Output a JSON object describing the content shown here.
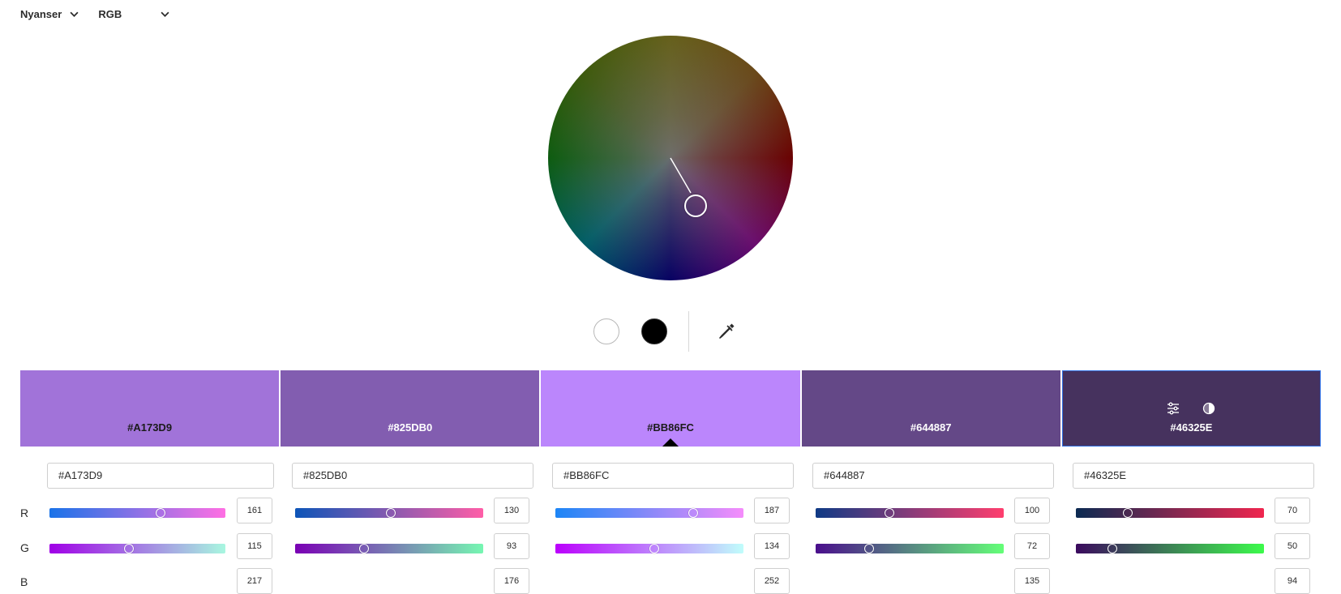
{
  "toolbar": {
    "mode": "Nyanser",
    "colormodel": "RGB"
  },
  "wheel": {
    "handle_color": "#BB86FC"
  },
  "tools": {
    "white_label": "white",
    "black_label": "black"
  },
  "row_labels": [
    "R",
    "G",
    "B"
  ],
  "swatches": [
    {
      "hex": "#A173D9",
      "bg": "#A173D9",
      "text_color": "#1b1b1b"
    },
    {
      "hex": "#825DB0",
      "bg": "#825DB0",
      "text_color": "#ffffff"
    },
    {
      "hex": "#BB86FC",
      "bg": "#BB86FC",
      "text_color": "#1b1b1b"
    },
    {
      "hex": "#644887",
      "bg": "#644887",
      "text_color": "#ffffff"
    },
    {
      "hex": "#46325E",
      "bg": "#46325E",
      "text_color": "#ffffff"
    }
  ],
  "editors": [
    {
      "hex": "#A173D9",
      "r": "161",
      "g": "115",
      "b": "217",
      "r_grad": [
        "#1a73e8",
        "#ff6fe3"
      ],
      "g_grad": [
        "#a000e6",
        "#a8f7e0"
      ]
    },
    {
      "hex": "#825DB0",
      "r": "130",
      "g": "93",
      "b": "176",
      "r_grad": [
        "#0d55b8",
        "#ff5ea7"
      ],
      "g_grad": [
        "#7a00b4",
        "#76f7b2"
      ]
    },
    {
      "hex": "#BB86FC",
      "r": "187",
      "g": "134",
      "b": "252",
      "r_grad": [
        "#1d86f6",
        "#f58cfb"
      ],
      "g_grad": [
        "#bb00fc",
        "#c0fdfb"
      ]
    },
    {
      "hex": "#644887",
      "r": "100",
      "g": "72",
      "b": "135",
      "r_grad": [
        "#0f3a85",
        "#ff3e6e"
      ],
      "g_grad": [
        "#4a0e8c",
        "#64ff78"
      ]
    },
    {
      "hex": "#46325E",
      "r": "70",
      "g": "50",
      "b": "94",
      "r_grad": [
        "#0b2a52",
        "#f0264f"
      ],
      "g_grad": [
        "#3b0a5e",
        "#3cfb4c"
      ]
    }
  ]
}
